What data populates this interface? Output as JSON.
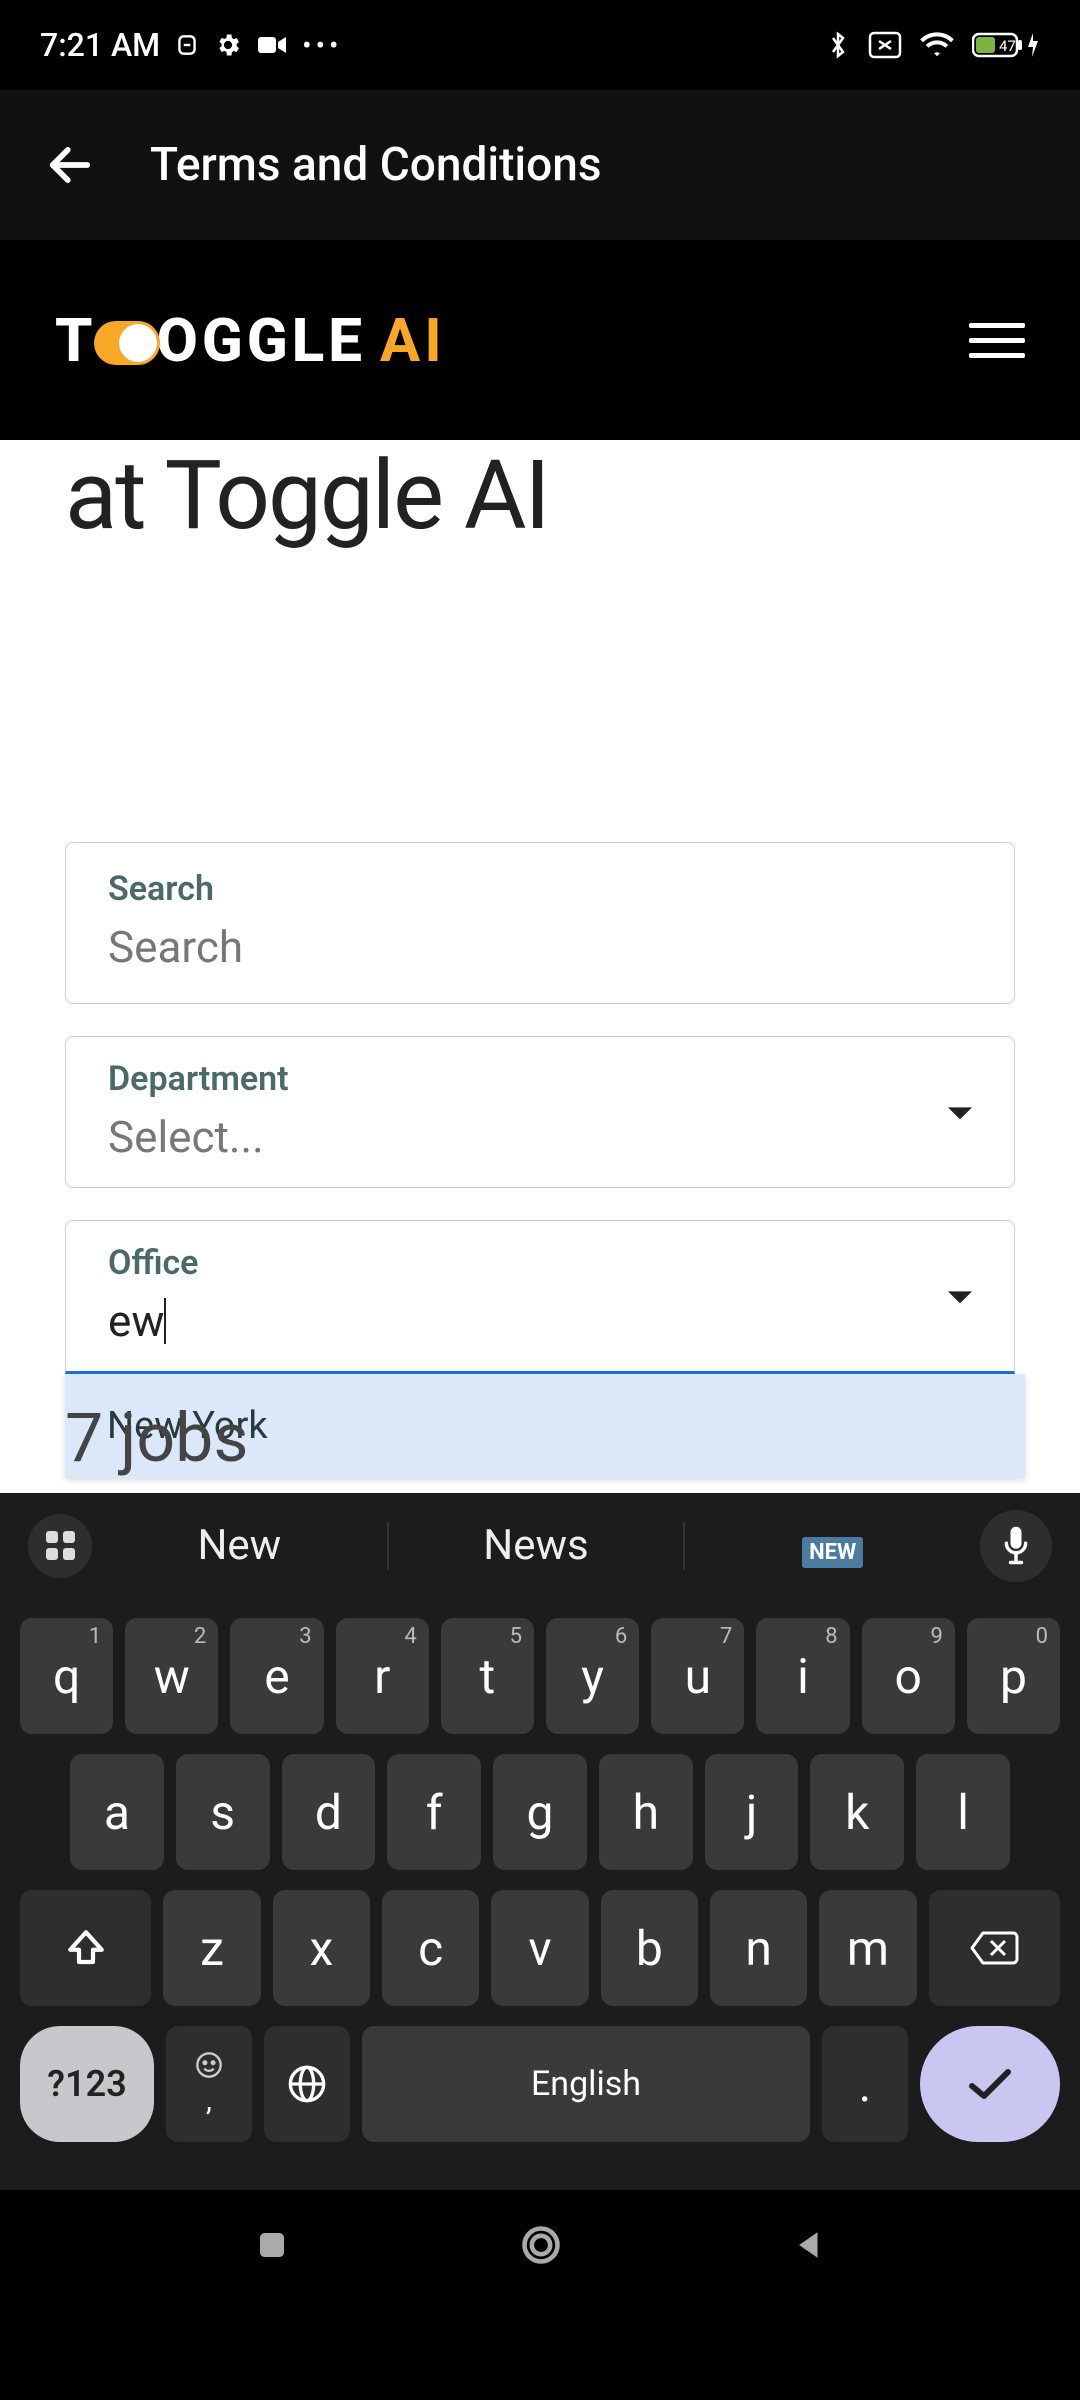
{
  "status": {
    "time": "7:21 AM",
    "battery": "47"
  },
  "header": {
    "title": "Terms and Conditions"
  },
  "brand": {
    "t": "T",
    "oggle": "OGGLE",
    "ai": "AI"
  },
  "page": {
    "heading": "at Toggle AI",
    "jobs_count": "7 jobs"
  },
  "form": {
    "search": {
      "label": "Search",
      "placeholder": "Search",
      "value": ""
    },
    "department": {
      "label": "Department",
      "placeholder": "Select..."
    },
    "office": {
      "label": "Office",
      "value": "ew",
      "option": "New York"
    }
  },
  "suggestions": {
    "s1": "New",
    "s2": "News",
    "s3_badge": "NEW"
  },
  "keyboard": {
    "row1": [
      {
        "k": "q",
        "n": "1"
      },
      {
        "k": "w",
        "n": "2"
      },
      {
        "k": "e",
        "n": "3"
      },
      {
        "k": "r",
        "n": "4"
      },
      {
        "k": "t",
        "n": "5"
      },
      {
        "k": "y",
        "n": "6"
      },
      {
        "k": "u",
        "n": "7"
      },
      {
        "k": "i",
        "n": "8"
      },
      {
        "k": "o",
        "n": "9"
      },
      {
        "k": "p",
        "n": "0"
      }
    ],
    "row2": [
      "a",
      "s",
      "d",
      "f",
      "g",
      "h",
      "j",
      "k",
      "l"
    ],
    "row3": [
      "z",
      "x",
      "c",
      "v",
      "b",
      "n",
      "m"
    ],
    "sym": "?123",
    "space": "English",
    "comma": ",",
    "dot": "."
  }
}
